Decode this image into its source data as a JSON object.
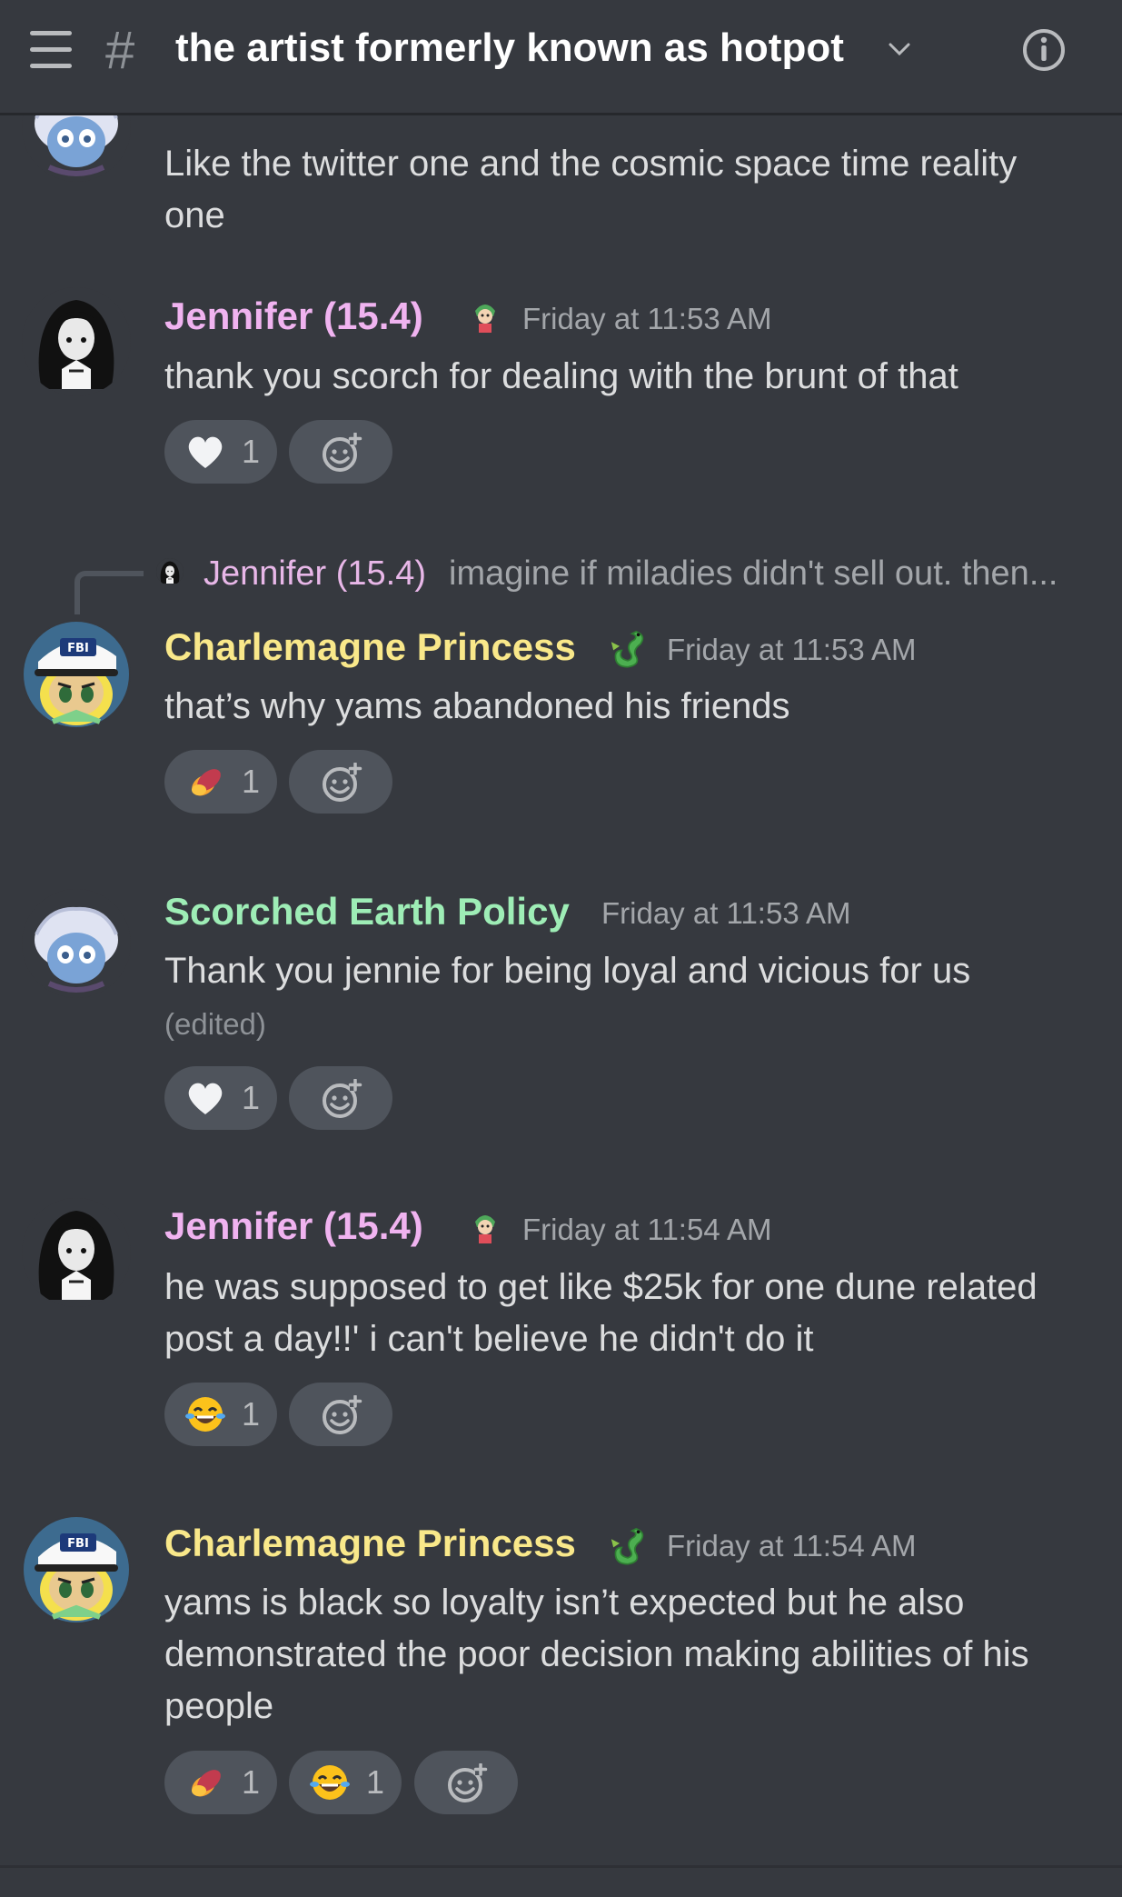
{
  "header": {
    "channel_name": "the artist formerly known as hotpot",
    "hash": "#"
  },
  "colors": {
    "jennifer": "#f0b3f0",
    "charlemagne": "#f9e88a",
    "scorched": "#9eedb6",
    "background": "#36393f",
    "pill": "#4f545c"
  },
  "partial_message": {
    "text": "Like the twitter one and the cosmic space time reality one"
  },
  "messages": [
    {
      "author": "Jennifer (15.4)",
      "timestamp": "Friday at 11:53 AM",
      "text": "thank you scorch for dealing with the brunt of that",
      "reactions": [
        {
          "emoji": "heart-icon",
          "count": "1"
        }
      ]
    },
    {
      "reply": {
        "author": "Jennifer (15.4)",
        "text": "imagine if miladies didn't sell out. then..."
      },
      "author": "Charlemagne Princess",
      "timestamp": "Friday at 11:53 AM",
      "text": "that’s why yams abandoned his friends",
      "reactions": [
        {
          "emoji": "sweet-potato-icon",
          "count": "1"
        }
      ]
    },
    {
      "author": "Scorched Earth Policy",
      "timestamp": "Friday at 11:53 AM",
      "text": "Thank you jennie for being loyal and vicious for us",
      "edited": "(edited)",
      "reactions": [
        {
          "emoji": "heart-icon",
          "count": "1"
        }
      ]
    },
    {
      "author": "Jennifer (15.4)",
      "timestamp": "Friday at 11:54 AM",
      "text": "he was supposed to get like $25k for one dune related post a day!!' i can't believe he didn't do it",
      "reactions": [
        {
          "emoji": "tears-of-joy-icon",
          "count": "1"
        }
      ]
    },
    {
      "author": "Charlemagne Princess",
      "timestamp": "Friday at 11:54 AM",
      "text": "yams is black so loyalty isn’t expected but he also demonstrated the poor decision making abilities of his people",
      "reactions": [
        {
          "emoji": "sweet-potato-icon",
          "count": "1"
        },
        {
          "emoji": "tears-of-joy-icon",
          "count": "1"
        }
      ]
    }
  ]
}
